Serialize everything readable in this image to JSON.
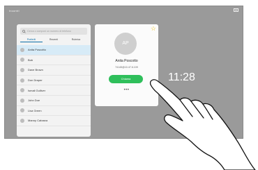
{
  "topbar": {
    "label": "Incontri"
  },
  "search": {
    "placeholder": "Cerca o componi un numero di telefono"
  },
  "tabs": [
    {
      "label": "Preferiti",
      "active": true
    },
    {
      "label": "Recenti",
      "active": false
    },
    {
      "label": "Rubrica",
      "active": false
    }
  ],
  "contacts": [
    {
      "name": "Anita Poscotto",
      "selected": true
    },
    {
      "name": "Bob",
      "selected": false
    },
    {
      "name": "Dave Brown",
      "selected": false
    },
    {
      "name": "Don Draper",
      "selected": false
    },
    {
      "name": "Ismail Gulliver",
      "selected": false
    },
    {
      "name": "John Doe",
      "selected": false
    },
    {
      "name": "Lisa Green",
      "selected": false
    },
    {
      "name": "Manny Cabasra",
      "selected": false
    }
  ],
  "detail": {
    "initials": "AP",
    "name": "Anita Poscotto",
    "address": "74145@10.47.6.109",
    "call_label": "Chiama",
    "more_label": "•••",
    "favorite_icon": "star-icon"
  },
  "clock": "11:28",
  "colors": {
    "background": "#9a9a9a",
    "accent": "#0a6ea8",
    "call": "#2fbf5b",
    "star": "#f0c419"
  }
}
